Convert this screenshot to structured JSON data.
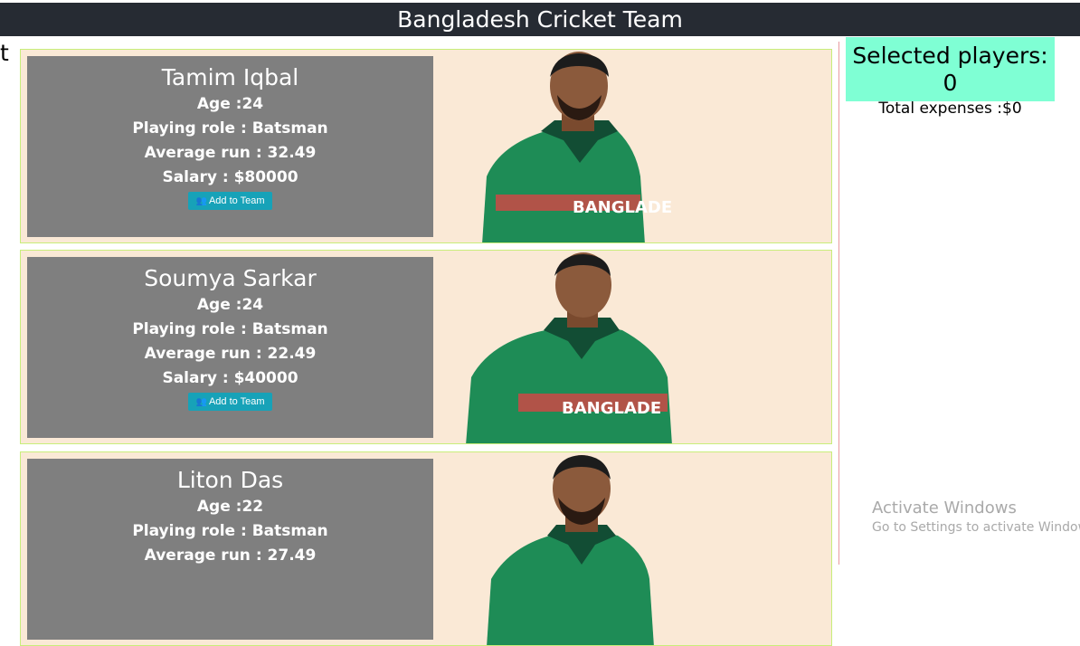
{
  "header": {
    "title": "Bangladesh Cricket Team"
  },
  "stray_text": "t",
  "players": [
    {
      "name": "Tamim Iqbal",
      "age": "Age :24",
      "role": "Playing role : Batsman",
      "average": "Average run : 32.49",
      "salary": "Salary : $80000",
      "button": "Add to Team"
    },
    {
      "name": "Soumya Sarkar",
      "age": "Age :24",
      "role": "Playing role : Batsman",
      "average": "Average run : 22.49",
      "salary": "Salary : $40000",
      "button": "Add to Team"
    },
    {
      "name": "Liton Das",
      "age": "Age :22",
      "role": "Playing role : Batsman",
      "average": "Average run : 27.49",
      "salary": "",
      "button": ""
    }
  ],
  "summary": {
    "selected": "Selected players: 0",
    "expenses": "Total expenses :$0"
  },
  "watermark": {
    "line1": "Activate Windows",
    "line2": "Go to Settings to activate Windows."
  },
  "icons": {
    "button_icon": "users-icon"
  },
  "colors": {
    "header_bg": "#262b33",
    "card_bg": "#fae9d6",
    "info_bg": "#7f7f7f",
    "button_bg": "#17a2b8",
    "summary_bg": "#7fffd4",
    "jersey": "#1e8c56"
  }
}
